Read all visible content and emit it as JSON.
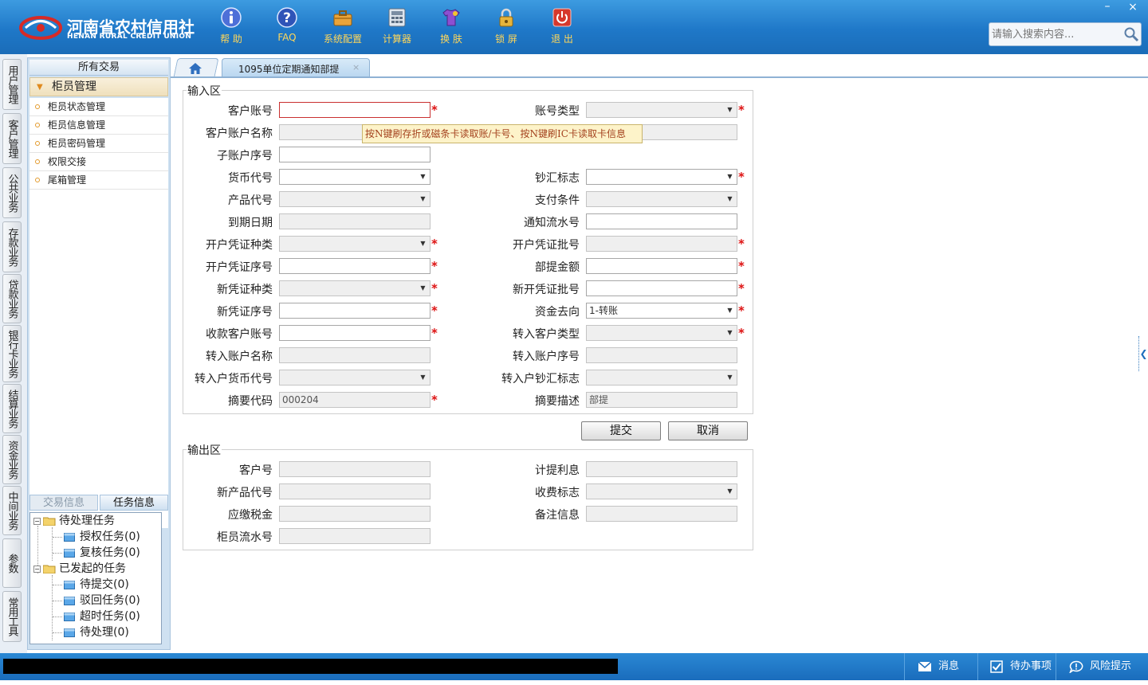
{
  "header": {
    "brand_cn": "河南省农村信用社",
    "brand_en": "HENAN RURAL CREDIT UNION",
    "toolbar": [
      {
        "label": "帮 助",
        "icon": "info-icon"
      },
      {
        "label": "FAQ",
        "icon": "help-icon"
      },
      {
        "label": "系统配置",
        "icon": "toolbox-icon"
      },
      {
        "label": "计算器",
        "icon": "calculator-icon"
      },
      {
        "label": "换 肤",
        "icon": "shirt-icon"
      },
      {
        "label": "锁 屏",
        "icon": "lock-icon"
      },
      {
        "label": "退 出",
        "icon": "power-icon"
      }
    ],
    "window_min": "–",
    "window_close": "×",
    "search": {
      "placeholder": "请输入搜索内容..."
    }
  },
  "vertical_tabs": [
    "用户管理",
    "客户管理",
    "公共业务",
    "存款业务",
    "贷款业务",
    "银行卡业务",
    "结算业务",
    "资金业务",
    "中间业务",
    "参数",
    "常用工具"
  ],
  "menu": {
    "header": "所有交易",
    "group": "柜员管理",
    "items": [
      "柜员状态管理",
      "柜员信息管理",
      "柜员密码管理",
      "权限交接",
      "尾箱管理"
    ]
  },
  "task_panel": {
    "tabs": [
      "交易信息",
      "任务信息"
    ],
    "active_tab": "任务信息",
    "pending": "待处理任务",
    "pending_items": [
      "授权任务(0)",
      "复核任务(0)"
    ],
    "started": "已发起的任务",
    "started_items": [
      "待提交(0)",
      "驳回任务(0)",
      "超时任务(0)",
      "待处理(0)"
    ]
  },
  "tabs": {
    "active": "1095单位定期通知部提",
    "close": "×"
  },
  "input_section": {
    "legend": "输入区",
    "tooltip": "按N键刷存折或磁条卡读取账/卡号、按N键刷IC卡读取卡信息",
    "fields": {
      "cust_account": {
        "label": "客户账号",
        "value": ""
      },
      "account_type": {
        "label": "账号类型",
        "value": ""
      },
      "cust_account_name": {
        "label": "客户账户名称",
        "value": ""
      },
      "sub_account_seq": {
        "label": "子账户序号",
        "value": ""
      },
      "currency": {
        "label": "货币代号",
        "value": ""
      },
      "cash_flag": {
        "label": "钞汇标志",
        "value": ""
      },
      "product_code": {
        "label": "产品代号",
        "value": ""
      },
      "payment_cond": {
        "label": "支付条件",
        "value": ""
      },
      "maturity_date": {
        "label": "到期日期",
        "value": ""
      },
      "notice_serial": {
        "label": "通知流水号",
        "value": ""
      },
      "open_voucher_type": {
        "label": "开户凭证种类",
        "value": ""
      },
      "open_voucher_batch": {
        "label": "开户凭证批号",
        "value": ""
      },
      "open_voucher_seq": {
        "label": "开户凭证序号",
        "value": ""
      },
      "partial_amount": {
        "label": "部提金额",
        "value": ""
      },
      "new_voucher_type": {
        "label": "新凭证种类",
        "value": ""
      },
      "new_voucher_batch": {
        "label": "新开凭证批号",
        "value": ""
      },
      "new_voucher_seq": {
        "label": "新凭证序号",
        "value": ""
      },
      "fund_direction": {
        "label": "资金去向",
        "value": "1-转账"
      },
      "payee_account": {
        "label": "收款客户账号",
        "value": ""
      },
      "in_cust_type": {
        "label": "转入客户类型",
        "value": ""
      },
      "in_account_name": {
        "label": "转入账户名称",
        "value": ""
      },
      "in_account_seq": {
        "label": "转入账户序号",
        "value": ""
      },
      "in_currency": {
        "label": "转入户货币代号",
        "value": ""
      },
      "in_cash_flag": {
        "label": "转入户钞汇标志",
        "value": ""
      },
      "summary_code": {
        "label": "摘要代码",
        "value": "000204"
      },
      "summary_desc": {
        "label": "摘要描述",
        "value": "部提"
      }
    },
    "submit": "提交",
    "cancel": "取消"
  },
  "output_section": {
    "legend": "输出区",
    "fields": {
      "cust_no": {
        "label": "客户号",
        "value": ""
      },
      "interest": {
        "label": "计提利息",
        "value": ""
      },
      "new_product": {
        "label": "新产品代号",
        "value": ""
      },
      "fee_flag": {
        "label": "收费标志",
        "value": ""
      },
      "tax": {
        "label": "应缴税金",
        "value": ""
      },
      "remark": {
        "label": "备注信息",
        "value": ""
      },
      "teller_serial": {
        "label": "柜员流水号",
        "value": ""
      }
    }
  },
  "statusbar": {
    "message": "消息",
    "todo": "待办事项",
    "risk": "风险提示"
  },
  "colors": {
    "header_blue": "#1f78c8",
    "toolbar_label": "#ffd75a",
    "required": "#dd1111",
    "tooltip_bg": "#fdf3c9"
  }
}
